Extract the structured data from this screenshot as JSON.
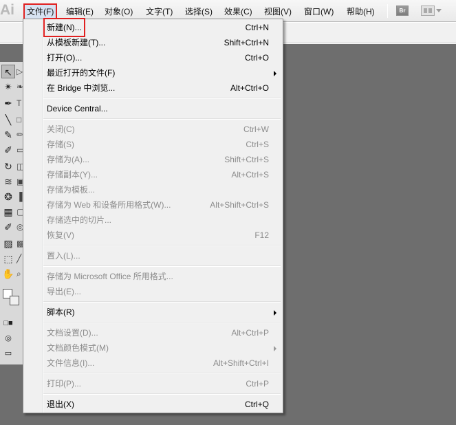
{
  "app": {
    "logo_text": "Ai"
  },
  "menubar": {
    "items": [
      {
        "label": "文件(F)"
      },
      {
        "label": "编辑(E)"
      },
      {
        "label": "对象(O)"
      },
      {
        "label": "文字(T)"
      },
      {
        "label": "选择(S)"
      },
      {
        "label": "效果(C)"
      },
      {
        "label": "视图(V)"
      },
      {
        "label": "窗口(W)"
      },
      {
        "label": "帮助(H)"
      }
    ],
    "bridge_button": "Br"
  },
  "file_menu": {
    "items": [
      {
        "label": "新建(N)...",
        "shortcut": "Ctrl+N",
        "enabled": true,
        "highlighted": true
      },
      {
        "label": "从模板新建(T)...",
        "shortcut": "Shift+Ctrl+N",
        "enabled": true
      },
      {
        "label": "打开(O)...",
        "shortcut": "Ctrl+O",
        "enabled": true
      },
      {
        "label": "最近打开的文件(F)",
        "shortcut": "",
        "enabled": true,
        "submenu": true
      },
      {
        "label": "在 Bridge 中浏览...",
        "shortcut": "Alt+Ctrl+O",
        "enabled": true
      },
      {
        "label": "Device Central...",
        "shortcut": "",
        "enabled": true
      },
      {
        "label": "关闭(C)",
        "shortcut": "Ctrl+W",
        "enabled": false
      },
      {
        "label": "存储(S)",
        "shortcut": "Ctrl+S",
        "enabled": false
      },
      {
        "label": "存储为(A)...",
        "shortcut": "Shift+Ctrl+S",
        "enabled": false
      },
      {
        "label": "存储副本(Y)...",
        "shortcut": "Alt+Ctrl+S",
        "enabled": false
      },
      {
        "label": "存储为模板...",
        "shortcut": "",
        "enabled": false
      },
      {
        "label": "存储为 Web 和设备所用格式(W)...",
        "shortcut": "Alt+Shift+Ctrl+S",
        "enabled": false
      },
      {
        "label": "存储选中的切片...",
        "shortcut": "",
        "enabled": false
      },
      {
        "label": "恢复(V)",
        "shortcut": "F12",
        "enabled": false
      },
      {
        "label": "置入(L)...",
        "shortcut": "",
        "enabled": false
      },
      {
        "label": "存储为 Microsoft Office 所用格式...",
        "shortcut": "",
        "enabled": false
      },
      {
        "label": "导出(E)...",
        "shortcut": "",
        "enabled": false
      },
      {
        "label": "脚本(R)",
        "shortcut": "",
        "enabled": true,
        "submenu": true
      },
      {
        "label": "文档设置(D)...",
        "shortcut": "Alt+Ctrl+P",
        "enabled": false
      },
      {
        "label": "文档颜色模式(M)",
        "shortcut": "",
        "enabled": false,
        "submenu": true
      },
      {
        "label": "文件信息(I)...",
        "shortcut": "Alt+Shift+Ctrl+I",
        "enabled": false
      },
      {
        "label": "打印(P)...",
        "shortcut": "Ctrl+P",
        "enabled": false
      },
      {
        "label": "退出(X)",
        "shortcut": "Ctrl+Q",
        "enabled": true
      }
    ]
  },
  "colors": {
    "canvas_bg": "#6e6e6e",
    "menu_bg": "#f0f0f0",
    "highlight_outline": "#e02020",
    "disabled_text": "#8d8d8d"
  }
}
